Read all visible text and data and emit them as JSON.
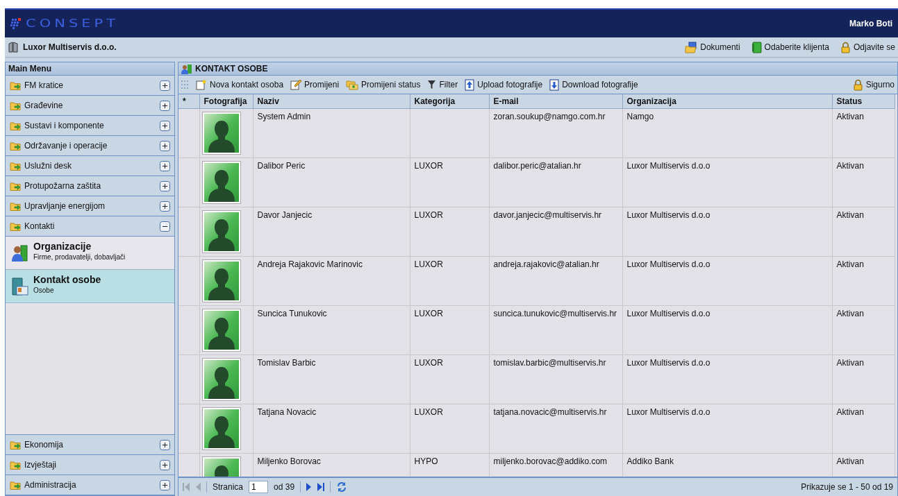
{
  "header": {
    "logo": "CONSEPT",
    "user": "Marko Boti"
  },
  "company_bar": {
    "company": "Luxor Multiservis d.o.o.",
    "links": [
      {
        "label": "Dokumenti",
        "kind": "documents"
      },
      {
        "label": "Odaberite klijenta",
        "kind": "book"
      },
      {
        "label": "Odjavite se",
        "kind": "lock"
      }
    ]
  },
  "main_menu": {
    "title": "Main Menu",
    "sections": [
      {
        "label": "FM kratice",
        "expanded": false
      },
      {
        "label": "Građevine",
        "expanded": false
      },
      {
        "label": "Sustavi i komponente",
        "expanded": false
      },
      {
        "label": "Održavanje i operacije",
        "expanded": false
      },
      {
        "label": "Uslužni desk",
        "expanded": false
      },
      {
        "label": "Protupožarna zaštita",
        "expanded": false
      },
      {
        "label": "Upravljanje energijom",
        "expanded": false
      },
      {
        "label": "Kontakti",
        "expanded": true,
        "children": [
          {
            "title": "Organizacije",
            "subtitle": "Firme, prodavatelji, dobavljači",
            "kind": "organizations",
            "selected": false
          },
          {
            "title": "Kontakt osobe",
            "subtitle": "Osobe",
            "kind": "contacts",
            "selected": true
          }
        ]
      },
      {
        "label": "Ekonomija",
        "expanded": false
      },
      {
        "label": "Izvještaji",
        "expanded": false
      },
      {
        "label": "Administracija",
        "expanded": false
      }
    ]
  },
  "panel": {
    "title": "KONTAKT OSOBE",
    "toolbar": [
      {
        "label": "Nova kontakt osoba",
        "kind": "new"
      },
      {
        "label": "Promijeni",
        "kind": "edit"
      },
      {
        "label": "Promijeni status",
        "kind": "status"
      },
      {
        "label": "Filter",
        "kind": "filter"
      },
      {
        "label": "Upload fotografije",
        "kind": "upload"
      },
      {
        "label": "Download fotografije",
        "kind": "download"
      }
    ],
    "toolbar_right": {
      "label": "Sigurno",
      "kind": "lock"
    }
  },
  "table": {
    "columns": [
      "*",
      "Fotografija",
      "Naziv",
      "Kategorija",
      "E-mail",
      "Organizacija",
      "Status"
    ],
    "rows": [
      {
        "name": "System Admin",
        "category": "",
        "email": "zoran.soukup@namgo.com.hr",
        "organization": "Namgo",
        "status": "Aktivan"
      },
      {
        "name": "Dalibor Peric",
        "category": "LUXOR",
        "email": "dalibor.peric@atalian.hr",
        "organization": "Luxor Multiservis d.o.o",
        "status": "Aktivan"
      },
      {
        "name": "Davor Janjecic",
        "category": "LUXOR",
        "email": "davor.janjecic@multiservis.hr",
        "organization": "Luxor Multiservis d.o.o",
        "status": "Aktivan"
      },
      {
        "name": "Andreja Rajakovic Marinovic",
        "category": "LUXOR",
        "email": "andreja.rajakovic@atalian.hr",
        "organization": "Luxor Multiservis d.o.o",
        "status": "Aktivan"
      },
      {
        "name": "Suncica Tunukovic",
        "category": "LUXOR",
        "email": "suncica.tunukovic@multiservis.hr",
        "organization": "Luxor Multiservis d.o.o",
        "status": "Aktivan"
      },
      {
        "name": "Tomislav Barbic",
        "category": "LUXOR",
        "email": "tomislav.barbic@multiservis.hr",
        "organization": "Luxor Multiservis d.o.o",
        "status": "Aktivan"
      },
      {
        "name": "Tatjana Novacic",
        "category": "LUXOR",
        "email": "tatjana.novacic@multiservis.hr",
        "organization": "Luxor Multiservis d.o.o",
        "status": "Aktivan"
      },
      {
        "name": "Miljenko Borovac",
        "category": "HYPO",
        "email": "miljenko.borovac@addiko.com",
        "organization": "Addiko Bank",
        "status": "Aktivan"
      }
    ]
  },
  "pager": {
    "page_label": "Stranica",
    "page": "1",
    "of": "od 39",
    "summary": "Prikazuje se 1 - 50 od 19"
  }
}
